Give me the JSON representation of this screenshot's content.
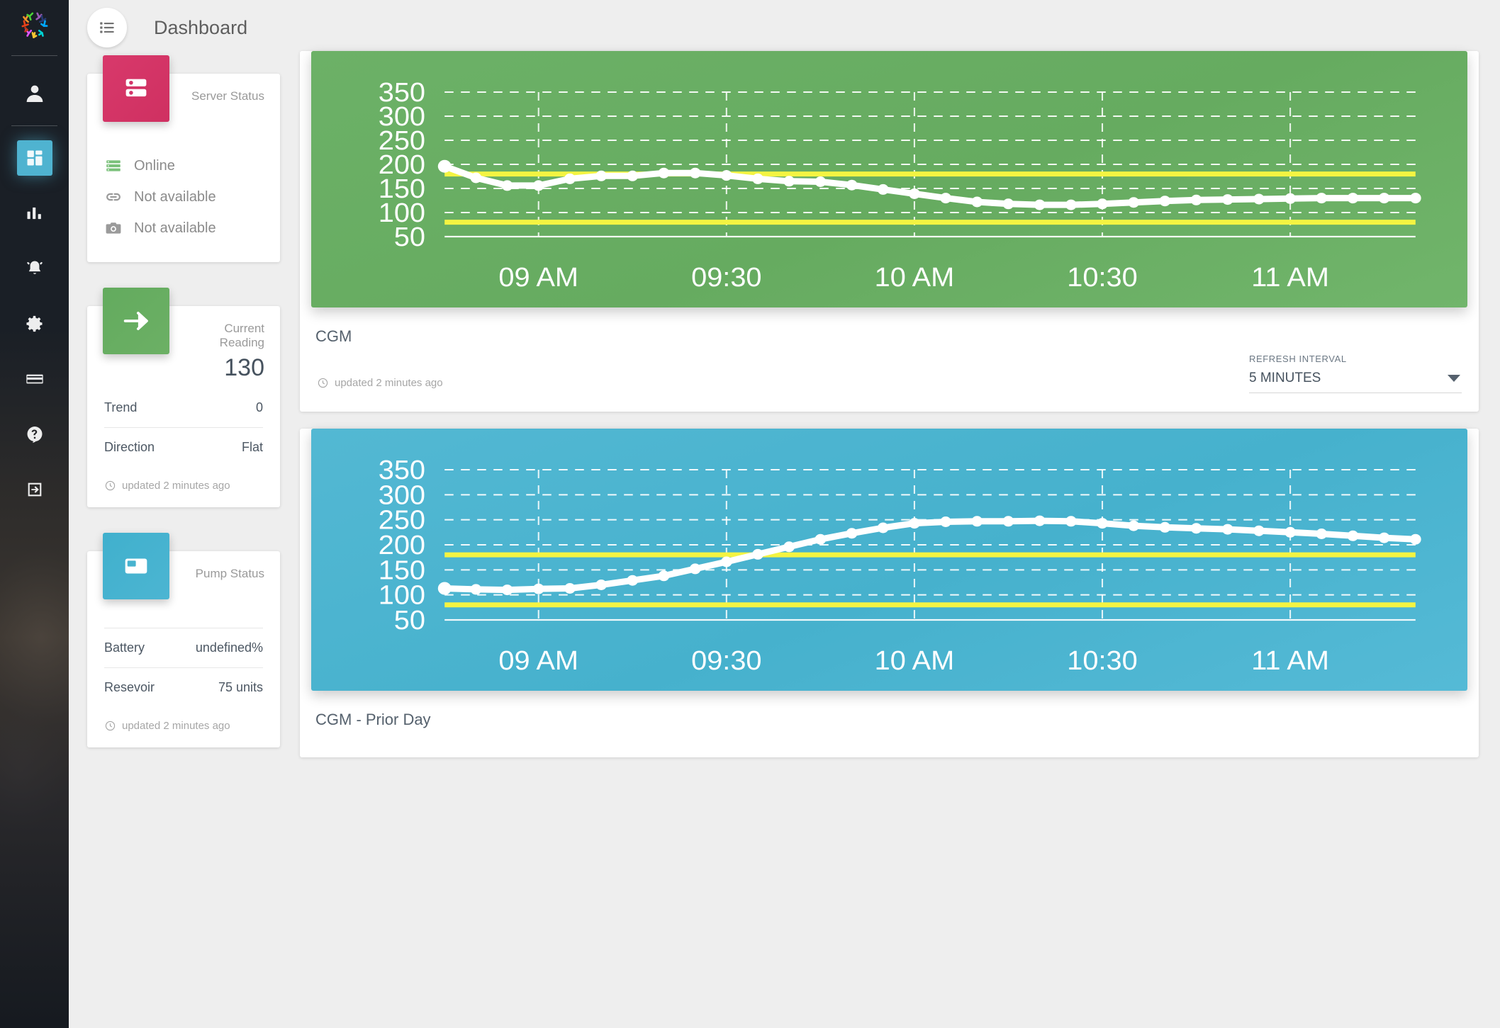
{
  "app": {
    "logo_name": "nightscout-logo",
    "page_title": "Dashboard",
    "menu_icon": "list-menu-icon"
  },
  "sidebar": {
    "items": [
      {
        "name": "profile",
        "icon": "person-icon",
        "active": false
      },
      {
        "name": "dashboard",
        "icon": "dashboard-grid-icon",
        "active": true
      },
      {
        "name": "reports",
        "icon": "bar-chart-icon",
        "active": false
      },
      {
        "name": "alarms",
        "icon": "bell-icon",
        "active": false
      },
      {
        "name": "settings",
        "icon": "gear-icon",
        "active": false
      },
      {
        "name": "billing",
        "icon": "credit-card-icon",
        "active": false
      },
      {
        "name": "help",
        "icon": "question-mark-icon",
        "active": false
      },
      {
        "name": "logout",
        "icon": "logout-arrow-icon",
        "active": false
      }
    ]
  },
  "cards": {
    "server_status": {
      "title": "Server Status",
      "icon": "server-rack-icon",
      "icon_color": "#d3356a",
      "rows": [
        {
          "icon": "server-icon",
          "icon_color": "#7bc17b",
          "text": "Online"
        },
        {
          "icon": "link-icon",
          "icon_color": "#9a9a9a",
          "text": "Not available"
        },
        {
          "icon": "camera-icon",
          "icon_color": "#9a9a9a",
          "text": "Not available"
        }
      ]
    },
    "current_reading": {
      "title": "Current Reading",
      "value": "130",
      "icon": "arrow-right-icon",
      "icon_color": "#68ae62",
      "rows": [
        {
          "label": "Trend",
          "value": "0"
        },
        {
          "label": "Direction",
          "value": "Flat"
        }
      ],
      "updated": "updated 2 minutes ago"
    },
    "pump_status": {
      "title": "Pump Status",
      "icon": "pump-icon",
      "icon_color": "#48b3cf",
      "rows": [
        {
          "label": "Battery",
          "value": "undefined%"
        },
        {
          "label": "Resevoir",
          "value": "75 units"
        }
      ],
      "updated": "updated 2 minutes ago"
    }
  },
  "panels": {
    "cgm": {
      "title": "CGM",
      "updated": "updated 2 minutes ago",
      "refresh": {
        "label": "REFRESH INTERVAL",
        "value": "5 MINUTES",
        "caret_icon": "chevron-down-icon"
      }
    },
    "cgm_prior": {
      "title": "CGM - Prior Day"
    }
  },
  "chart_data": [
    {
      "id": "cgm-today",
      "type": "line",
      "title": "CGM",
      "bg_color": "#69ad63",
      "line_color": "#ffffff",
      "threshold_color": "#f4f442",
      "thresholds": [
        180,
        80
      ],
      "grid": true,
      "xlabel": "",
      "ylabel": "",
      "ylim": [
        50,
        350
      ],
      "yticks": [
        50,
        100,
        150,
        200,
        250,
        300,
        350
      ],
      "xticks": [
        "09 AM",
        "09:30",
        "10 AM",
        "10:30",
        "11 AM"
      ],
      "x": [
        "08:45",
        "08:50",
        "08:55",
        "09:00",
        "09:05",
        "09:10",
        "09:15",
        "09:20",
        "09:25",
        "09:30",
        "09:35",
        "09:40",
        "09:45",
        "09:50",
        "09:55",
        "10:00",
        "10:05",
        "10:10",
        "10:15",
        "10:20",
        "10:25",
        "10:30",
        "10:35",
        "10:40",
        "10:45",
        "10:50",
        "10:55",
        "11:00",
        "11:05",
        "11:10",
        "11:15",
        "11:20"
      ],
      "values": [
        196,
        172,
        156,
        156,
        170,
        176,
        176,
        182,
        182,
        177,
        170,
        165,
        164,
        157,
        148,
        139,
        130,
        122,
        118,
        116,
        116,
        118,
        121,
        124,
        126,
        127,
        128,
        129,
        130,
        130,
        130,
        130
      ]
    },
    {
      "id": "cgm-prior-day",
      "type": "line",
      "title": "CGM - Prior Day",
      "bg_color": "#4cb4d0",
      "line_color": "#ffffff",
      "threshold_color": "#f4f442",
      "thresholds": [
        180,
        80
      ],
      "grid": true,
      "xlabel": "",
      "ylabel": "",
      "ylim": [
        50,
        350
      ],
      "yticks": [
        50,
        100,
        150,
        200,
        250,
        300,
        350
      ],
      "xticks": [
        "09 AM",
        "09:30",
        "10 AM",
        "10:30",
        "11 AM"
      ],
      "x": [
        "08:45",
        "08:50",
        "08:55",
        "09:00",
        "09:05",
        "09:10",
        "09:15",
        "09:20",
        "09:25",
        "09:30",
        "09:35",
        "09:40",
        "09:45",
        "09:50",
        "09:55",
        "10:00",
        "10:05",
        "10:10",
        "10:15",
        "10:20",
        "10:25",
        "10:30",
        "10:35",
        "10:40",
        "10:45",
        "10:50",
        "10:55",
        "11:00",
        "11:05",
        "11:10",
        "11:15",
        "11:20"
      ],
      "values": [
        113,
        111,
        110,
        112,
        113,
        120,
        129,
        138,
        152,
        166,
        181,
        196,
        211,
        223,
        234,
        243,
        246,
        247,
        247,
        248,
        247,
        243,
        238,
        235,
        233,
        231,
        228,
        225,
        222,
        218,
        214,
        211
      ]
    }
  ]
}
